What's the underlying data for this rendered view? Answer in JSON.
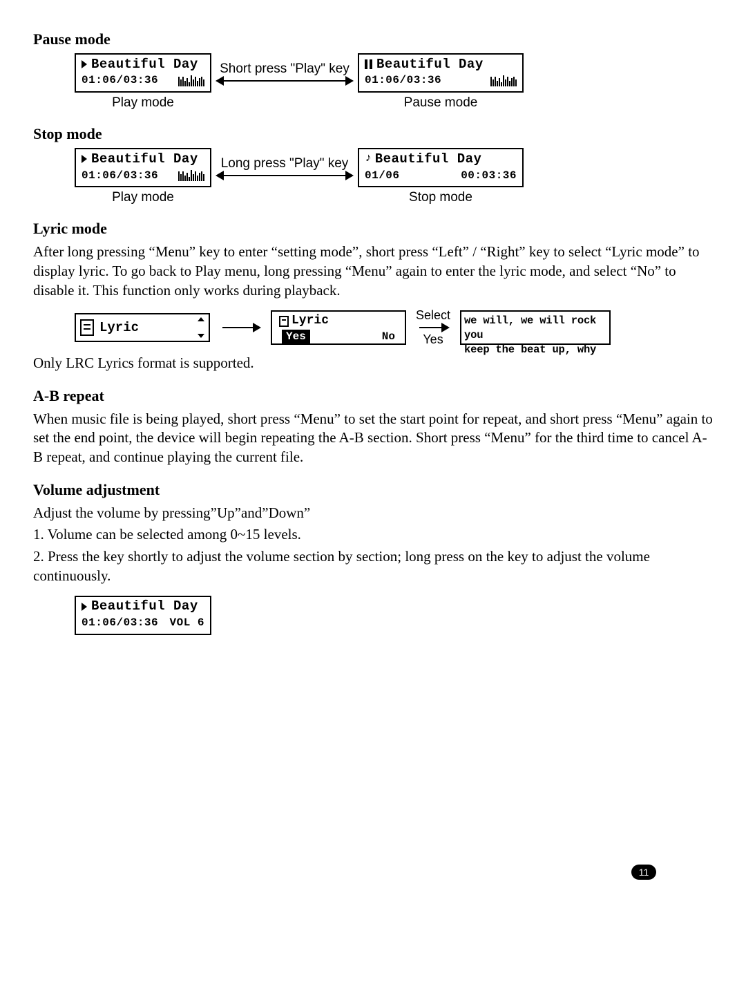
{
  "sections": {
    "pause_mode": {
      "heading": "Pause mode"
    },
    "stop_mode": {
      "heading": "Stop mode"
    },
    "lyric_mode": {
      "heading": "Lyric mode",
      "para": "After long pressing “Menu” key to enter “setting mode”, short press “Left” / “Right” key to select “Lyric mode” to display lyric. To go back to Play menu, long pressing “Menu” again to enter the lyric mode, and select “No” to disable it. This function only works during playback.",
      "note": "Only LRC Lyrics format is supported."
    },
    "ab_repeat": {
      "heading": "A-B repeat",
      "para": "When music file is being played, short press “Menu” to set the start point for repeat, and short press “Menu” again to set the end point, the device will begin repeating the A-B section. Short press “Menu” for the third time to cancel A-B repeat, and continue playing the current file."
    },
    "volume": {
      "heading": "Volume adjustment",
      "intro": "Adjust the volume by pressing”Up”and”Down”",
      "item1": "1. Volume can be selected among 0~15 levels.",
      "item2": "2. Press the key shortly to adjust the volume section by section; long press on the key to adjust the volume continuously."
    }
  },
  "screens": {
    "song_title": "Beautiful Day",
    "time_progress": "01:06/03:36",
    "stop_track": "01/06",
    "stop_total": "00:03:36",
    "vol_label": "VOL 6"
  },
  "arrows": {
    "short_press_play": "Short press \"Play\" key",
    "long_press_play": "Long press \"Play\" key"
  },
  "captions": {
    "play_mode": "Play mode",
    "pause_mode": "Pause mode",
    "stop_mode": "Stop mode"
  },
  "lyric_diagram": {
    "menu_label": "Lyric",
    "header": "Lyric",
    "yes": "Yes",
    "no": "No",
    "select": "Select",
    "select_yes": "Yes",
    "line1": "we will, we will rock you",
    "line2": "keep the beat up, why"
  },
  "page_number": "11"
}
